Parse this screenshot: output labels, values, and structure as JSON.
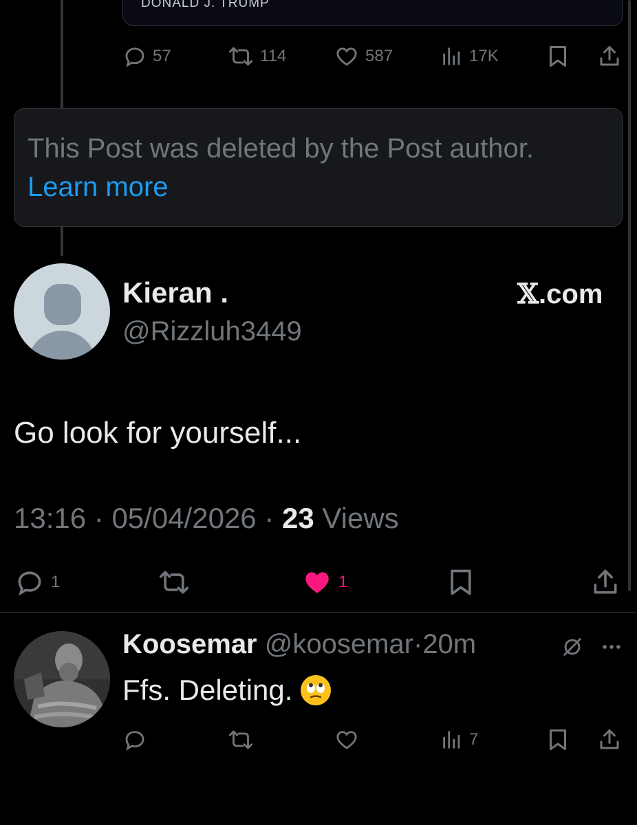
{
  "quoted_post": {
    "author_label": "DONALD J. TRUMP",
    "actions": {
      "replies": "57",
      "reposts": "114",
      "likes": "587",
      "views": "17K"
    }
  },
  "deleted_notice": {
    "text": "This Post was deleted by the Post author.",
    "link": "Learn more"
  },
  "main_post": {
    "display_name": "Kieran .",
    "handle": "@Rizzluh3449",
    "watermark": "X.com",
    "watermark_x": "𝕏",
    "watermark_rest": ".com",
    "text": "Go look for yourself...",
    "time": "13:16",
    "date": "05/04/2026",
    "views_count": "23",
    "views_label": "Views",
    "sep": "·",
    "actions": {
      "replies": "1",
      "likes": "1"
    },
    "like_color": "#f91880"
  },
  "reply": {
    "display_name": "Koosemar",
    "handle": "@koosemar",
    "sep": "·",
    "time": "20m",
    "text": "Ffs. Deleting.",
    "emoji_name": "face-with-rolling-eyes",
    "actions": {
      "views": "7"
    }
  },
  "colors": {
    "background": "#000000",
    "muted": "#71767b",
    "link": "#1d9bf0",
    "like_active": "#f91880"
  }
}
